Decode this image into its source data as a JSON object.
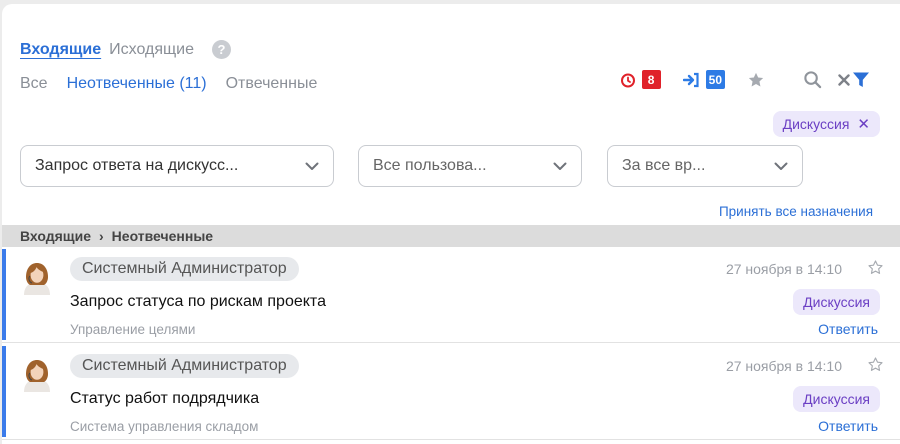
{
  "tabs": {
    "incoming": "Входящие",
    "outgoing": "Исходящие"
  },
  "help_icon_glyph": "?",
  "subtabs": {
    "all": "Все",
    "unanswered": "Неотвеченные (11)",
    "answered": "Отвеченные"
  },
  "counters": {
    "overdue": "8",
    "assigned": "50"
  },
  "colors": {
    "accent": "#2b6fd6",
    "overdue_red": "#e0222a",
    "assigned_blue": "#2d7be5",
    "chip_purple": "#6b3fc4",
    "chip_bg": "#ece8fb",
    "row_marker": "#3b7bea"
  },
  "active_filter": {
    "label": "Дискуссия",
    "remove_glyph": "✕"
  },
  "filters": {
    "request_type": {
      "value": "Запрос ответа на дискусс..."
    },
    "users": {
      "value": "Все пользова..."
    },
    "period": {
      "value": "За все вр..."
    }
  },
  "accept_all_link": "Принять все назначения",
  "breadcrumb": {
    "root": "Входящие",
    "separator": "›",
    "current": "Неотвеченные"
  },
  "messages": [
    {
      "sender": "Системный Администратор",
      "subject": "Запрос статуса по рискам проекта",
      "module": "Управление целями",
      "date": "27 ноября в 14:10",
      "type": "Дискуссия",
      "reply": "Ответить"
    },
    {
      "sender": "Системный Администратор",
      "subject": "Статус работ подрядчика",
      "module": "Система управления складом",
      "date": "27 ноября в 14:10",
      "type": "Дискуссия",
      "reply": "Ответить"
    }
  ]
}
